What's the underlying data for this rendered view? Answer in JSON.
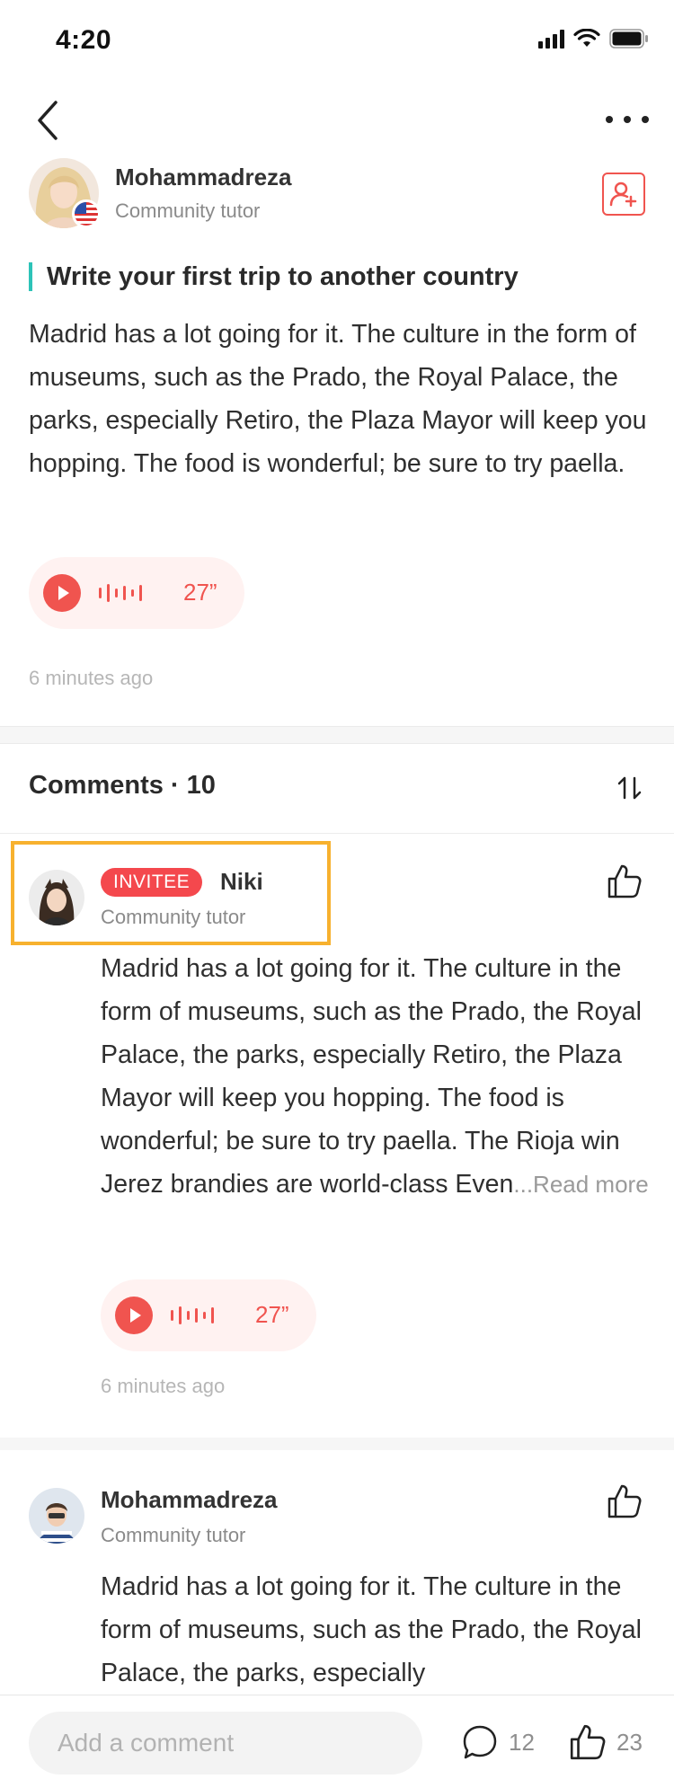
{
  "status_bar": {
    "time": "4:20"
  },
  "nav": {
    "back_icon": "chevron-left-icon",
    "more_icon": "more-horizontal-icon"
  },
  "post": {
    "author": {
      "name": "Mohammadreza",
      "role": "Community tutor",
      "flag": "us-flag-icon"
    },
    "title": "Write your first trip to another country",
    "body": "Madrid has a lot going for it. The culture in the form of museums, such as the Prado, the Royal Palace, the parks, especially Retiro, the Plaza Mayor will keep you hopping. The food is wonderful; be sure to try paella.",
    "audio_duration": "27”",
    "timestamp": "6 minutes ago"
  },
  "comments_section": {
    "title": "Comments · 10",
    "sort_icon": "sort-arrows-icon"
  },
  "comments": [
    {
      "badge": "INVITEE",
      "name": "Niki",
      "role": "Community tutor",
      "body": "Madrid has a lot going for it. The culture in the form of museums, such as the Prado, the Royal Palace, the parks, especially Retiro, the Plaza Mayor will keep you hopping. The food is wonderful; be sure to try paella. The Rioja win Jerez brandies are world-class Even",
      "read_more": "...Read more",
      "audio_duration": "27”",
      "timestamp": "6 minutes ago"
    },
    {
      "name": "Mohammadreza",
      "role": "Community tutor",
      "body": "Madrid has a lot going for it. The culture in the form of museums, such as the Prado, the Royal Palace, the parks, especially"
    }
  ],
  "bottom_bar": {
    "input_placeholder": "Add a comment",
    "comment_count": "12",
    "like_count": "23"
  },
  "colors": {
    "accent": "#f0544f",
    "title_bar": "#2dc3b8",
    "highlight": "#f7b12e"
  }
}
